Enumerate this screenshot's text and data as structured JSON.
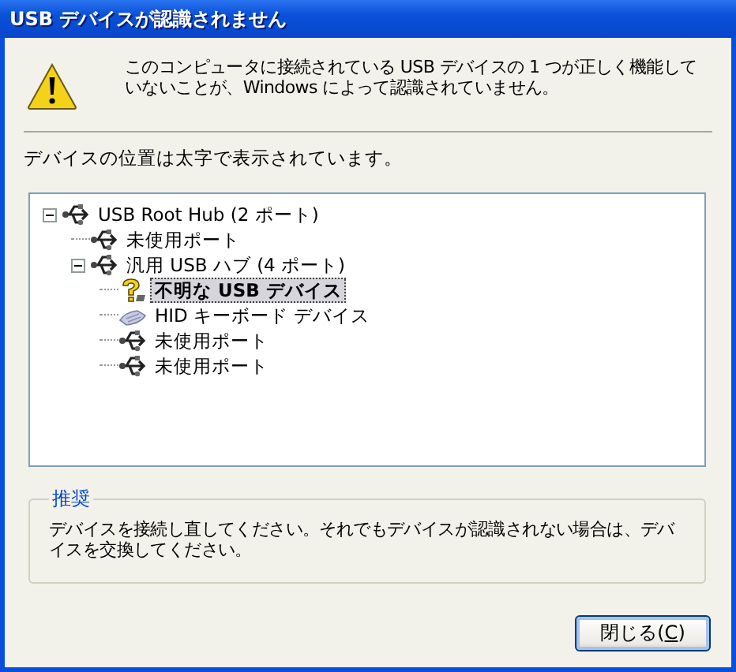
{
  "window": {
    "title": "USB デバイスが認識されません"
  },
  "message": "このコンピュータに接続されている USB デバイスの 1 つが正しく機能していないことが、Windows によって認識されていません。",
  "location_note": "デバイスの位置は太字で表示されています。",
  "tree": [
    {
      "label": "USB Root Hub (2 ポート)",
      "kind": "usb",
      "selected": false,
      "expanded": true,
      "children": [
        {
          "label": "未使用ポート",
          "kind": "usb",
          "selected": false
        },
        {
          "label": "汎用 USB ハブ (4 ポート)",
          "kind": "usb",
          "selected": false,
          "expanded": true,
          "children": [
            {
              "label": "不明な USB デバイス",
              "kind": "unknown",
              "selected": true
            },
            {
              "label": "HID キーボード デバイス",
              "kind": "keyboard",
              "selected": false
            },
            {
              "label": "未使用ポート",
              "kind": "usb",
              "selected": false
            },
            {
              "label": "未使用ポート",
              "kind": "usb",
              "selected": false
            }
          ]
        }
      ]
    }
  ],
  "recommendation": {
    "title": "推奨",
    "text": "デバイスを接続し直してください。それでもデバイスが認識されない場合は、デバイスを交換してください。"
  },
  "close_button": {
    "label_before": "閉じる(",
    "accesskey": "C",
    "label_after": ")"
  }
}
